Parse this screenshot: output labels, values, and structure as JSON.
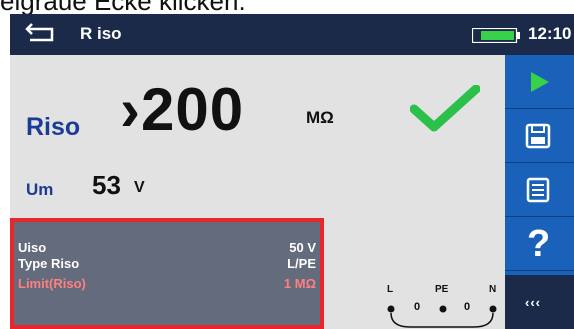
{
  "caption": "eigraue Ecke klicken.",
  "header": {
    "title": "R iso",
    "time": "12:10",
    "back_icon": "back-arrow-icon",
    "battery_icon": "battery-icon",
    "bg_color": "#1c2a4a"
  },
  "result": {
    "label": "Riso",
    "value": "›200",
    "unit": "MΩ",
    "status_icon": "check-icon",
    "status_color": "#2bc04a"
  },
  "um": {
    "label": "Um",
    "value": "53",
    "unit": "V"
  },
  "params": [
    {
      "label": "Uiso",
      "value": "50 V"
    },
    {
      "label": "Type Riso",
      "value": "L/PE"
    },
    {
      "label": "Limit(Riso)",
      "value": "1 MΩ"
    }
  ],
  "diagram": {
    "terminals": [
      "L",
      "PE",
      "N"
    ],
    "dot_label": "0"
  },
  "sidebar": {
    "buttons": [
      "play-icon",
      "save-icon",
      "list-icon",
      "help-icon",
      "more-icon"
    ],
    "help_text": "?",
    "more_text": "‹‹‹",
    "color": "#1a62b9"
  }
}
